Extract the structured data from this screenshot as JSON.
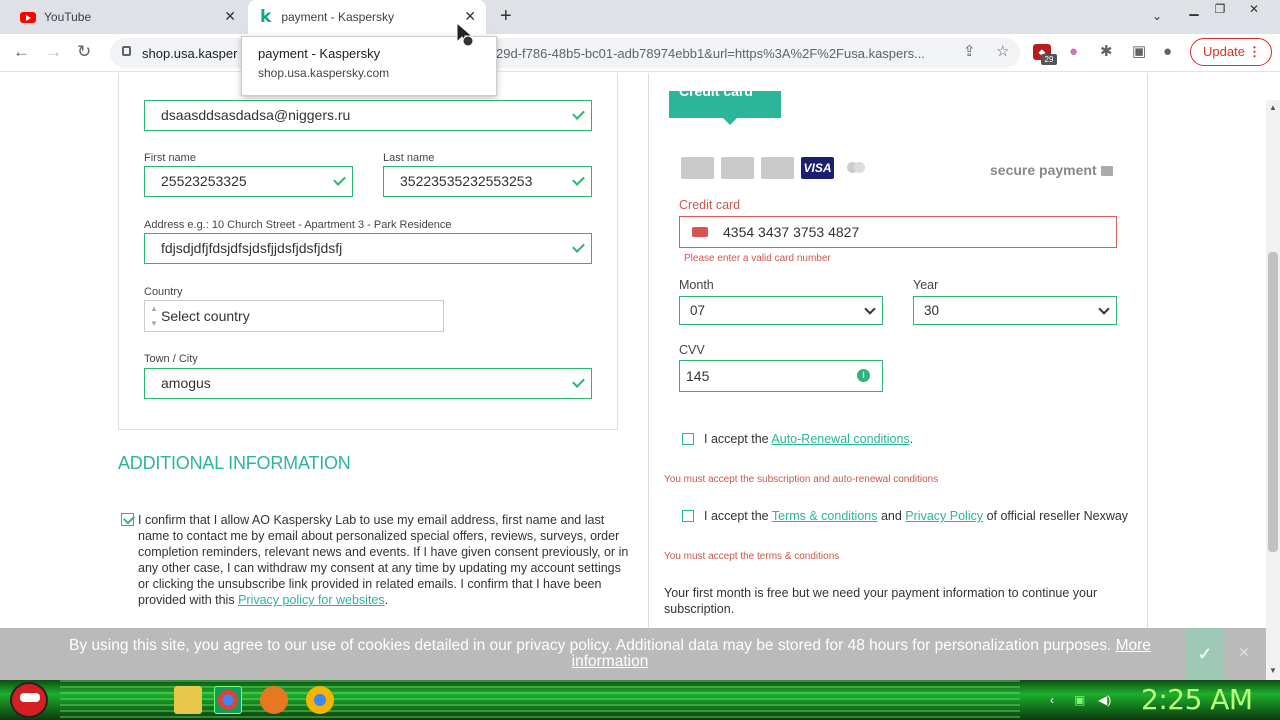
{
  "browser": {
    "tabs": [
      {
        "title": "YouTube"
      },
      {
        "title": "payment - Kaspersky"
      }
    ],
    "url_host": "shop.usa.kasper",
    "url_rest": "29d-f786-48b5-bc01-adb78974ebb1&url=https%3A%2F%2Fusa.kaspers...",
    "extension_count": "29",
    "update_label": "Update",
    "tooltip": {
      "title": "payment - Kaspersky",
      "host": "shop.usa.kaspersky.com"
    }
  },
  "left_form": {
    "email_value": "dsaasddsasdadsa@niggers.ru",
    "first_name_label": "First name",
    "first_name_value": "25523253325",
    "last_name_label": "Last name",
    "last_name_value": "35223535232553253",
    "address_label": "Address e.g.: 10 Church Street - Apartment 3 - Park Residence",
    "address_value": "fdjsdjdfjfdsjdfsjdsfjjdsfjdsfjdsfj",
    "country_label": "Country",
    "country_value": "Select country",
    "city_label": "Town / City",
    "city_value": "amogus"
  },
  "additional": {
    "title": "ADDITIONAL INFORMATION",
    "consent_text": "I confirm that I allow AO Kaspersky Lab to use my email address, first name and last name to contact me by email about personalized special offers, reviews, surveys, order completion reminders, relevant news and events. If I have given consent previously, or in any other case, I can withdraw my consent at any time by updating my account settings or clicking the unsubscribe link provided in related emails. I confirm that I have been provided with this ",
    "consent_link": "Privacy policy for websites",
    "consent_end": "."
  },
  "payment": {
    "tab_label": "Credit card",
    "visa_label": "VISA",
    "secure_label": "secure payment",
    "cc_label": "Credit card",
    "cc_value": "4354 3437 3753 4827",
    "cc_error": "Please enter a valid card number",
    "month_label": "Month",
    "month_value": "07",
    "year_label": "Year",
    "year_value": "30",
    "cvv_label": "CVV",
    "cvv_value": "145",
    "auto_renew_prefix": "I accept the ",
    "auto_renew_link": "Auto-Renewal conditions",
    "auto_renew_suffix": ".",
    "auto_renew_error": "You must accept the subscription and auto-renewal conditions",
    "terms_prefix": "I accept the ",
    "terms_link": "Terms & conditions",
    "terms_and": " and ",
    "privacy_link": "Privacy Policy",
    "terms_suffix": " of official reseller Nexway",
    "terms_error": "You must accept the terms & conditions",
    "free_text": "Your first month is free but we need your payment information to continue your subscription."
  },
  "cookie": {
    "text": "By using this site, you agree to our use of cookies detailed in our privacy policy. Additional data may be stored for 48 hours for personalization purposes. ",
    "more_link": "More information"
  },
  "taskbar": {
    "clock": "2:25 AM"
  },
  "colors": {
    "accent": "#2bb69a",
    "error": "#d9534f",
    "valid": "#2bb673"
  }
}
